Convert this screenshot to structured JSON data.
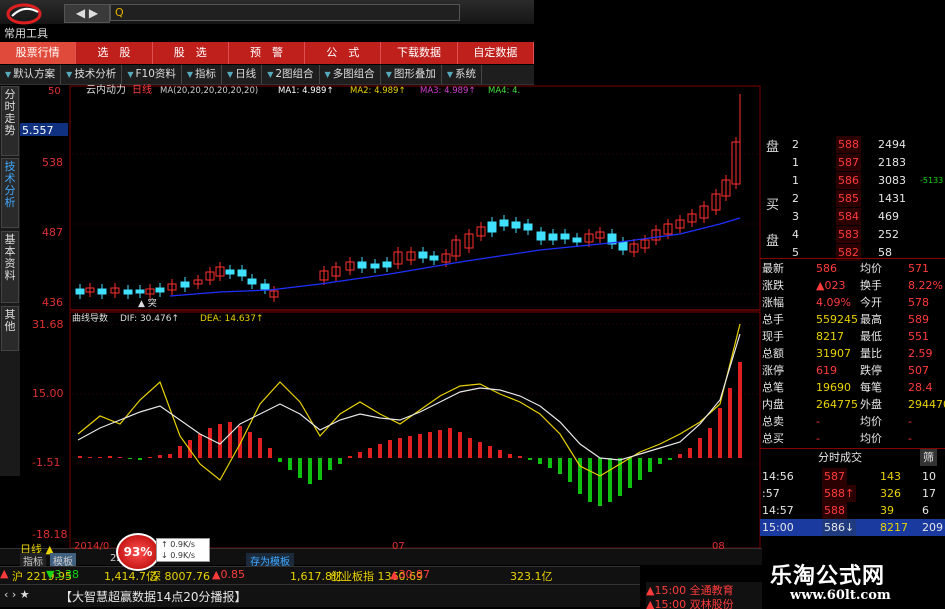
{
  "app": {
    "toolbar_name": "常用工具",
    "search_placeholder": "Q",
    "nav_back": "◀ ▶"
  },
  "module_tabs": [
    "股票行情",
    "选　股",
    "股　选",
    "预　警",
    "公　式",
    "下载数据",
    "自定数据"
  ],
  "tool_buttons": [
    "默认方案",
    "技术分析",
    "F10资料",
    "指标",
    "日线",
    "2图组合",
    "多图组合",
    "图形叠加",
    "系统"
  ],
  "vertical_tabs": [
    "分时走势",
    "技术分析",
    "基本资料",
    "其他"
  ],
  "main_chart": {
    "indicator_name": "云内动力",
    "period": "日线",
    "ma_label": "MA(20,20,20,20,20,20)",
    "ma_values": [
      {
        "name": "MA1",
        "value": "4.989↑"
      },
      {
        "name": "MA2",
        "value": "4.989↑"
      },
      {
        "name": "MA3",
        "value": "4.989↑"
      },
      {
        "name": "MA4",
        "value": "4."
      }
    ],
    "y_ticks": [
      "5.557",
      "538",
      "487",
      "436"
    ],
    "y_top_tick": "50",
    "left_marker": "突"
  },
  "sub_chart": {
    "name": "曲线导数",
    "dif": "DIF: 30.476↑",
    "dea": "DEA: 14.637↑",
    "y_ticks": [
      "31.68",
      "15.00",
      "-1.51",
      "-18.18"
    ]
  },
  "order_book": {
    "sell_label": "盘",
    "buy_label": "买盘",
    "sells": [
      {
        "level": "2",
        "price": "588",
        "vol": "2494"
      },
      {
        "level": "1",
        "price": "587",
        "vol": "2183"
      }
    ],
    "buys": [
      {
        "level": "1",
        "price": "586",
        "vol": "3083",
        "extra": "-5133"
      },
      {
        "level": "2",
        "price": "585",
        "vol": "1431"
      },
      {
        "level": "3",
        "price": "584",
        "vol": "469"
      },
      {
        "level": "4",
        "price": "583",
        "vol": "252"
      },
      {
        "level": "5",
        "price": "582",
        "vol": "58"
      }
    ],
    "stats": [
      {
        "l": "最新",
        "v": "586",
        "l2": "均价",
        "v2": "571"
      },
      {
        "l": "涨跌",
        "v": "▲023",
        "l2": "换手",
        "v2": "8.22%"
      },
      {
        "l": "涨幅",
        "v": "4.09%",
        "l2": "今开",
        "v2": "578"
      },
      {
        "l": "总手",
        "v": "559245",
        "l2": "最高",
        "v2": "589"
      },
      {
        "l": "现手",
        "v": "8217",
        "l2": "最低",
        "v2": "551"
      },
      {
        "l": "总额",
        "v": "31907",
        "l2": "量比",
        "v2": "2.59"
      },
      {
        "l": "涨停",
        "v": "619",
        "l2": "跌停",
        "v2": "507"
      },
      {
        "l": "总笔",
        "v": "19690",
        "l2": "每笔",
        "v2": "28.4"
      },
      {
        "l": "内盘",
        "v": "264775",
        "l2": "外盘",
        "v2": "294470"
      },
      {
        "l": "总卖",
        "v": "-",
        "l2": "均价",
        "v2": "-"
      },
      {
        "l": "总买",
        "v": "-",
        "l2": "均价",
        "v2": "-"
      }
    ],
    "trades_header": "分时成交",
    "trades_btn": "筛",
    "trades": [
      {
        "t": "14:56",
        "p": "587",
        "v": "143",
        "n": "10"
      },
      {
        "t": ":57",
        "p": "588↑",
        "v": "326",
        "n": "17"
      },
      {
        "t": "14:57",
        "p": "588",
        "v": "39",
        "n": "6"
      },
      {
        "t": "15:00",
        "p": "586↓",
        "v": "8217",
        "n": "209"
      }
    ]
  },
  "bottom": {
    "period_tab": "日线",
    "indicator_tabs": [
      "指标",
      "模板"
    ],
    "x_tick_left": "2014/0",
    "x_tick_mid": "07",
    "x_tick_right": "08",
    "x_tick_small": "22",
    "percent_badge": "93%",
    "speed_up": "0.9K/s",
    "speed_down": "0.9K/s",
    "save_template": "存为模板",
    "index_line": [
      {
        "name": "沪",
        "v": "2219.95"
      },
      {
        "name": "",
        "v": "▼3.38"
      },
      {
        "name": "",
        "v": "1,414.7亿"
      },
      {
        "name": "深",
        "v": "8007.76"
      },
      {
        "name": "",
        "v": "▲0.85"
      },
      {
        "name": "",
        "v": "1,617.8亿"
      },
      {
        "name": "创业板指",
        "v": "1360.69"
      },
      {
        "name": "",
        "v": "▲30.87"
      },
      {
        "name": "",
        "v": "323.1亿"
      }
    ],
    "news": "【大智慧超赢数据14点20分播报】",
    "news_right1": "▲15:00 全通教育",
    "news_right2": "▲15:00 双林股份"
  },
  "watermark": {
    "line1": "乐淘公式网",
    "line2": "www.60lt.com"
  },
  "colors": {
    "up": "#ff3b3b",
    "down": "#14d614",
    "accent": "#c0201c",
    "cyan": "#40e0ff"
  }
}
